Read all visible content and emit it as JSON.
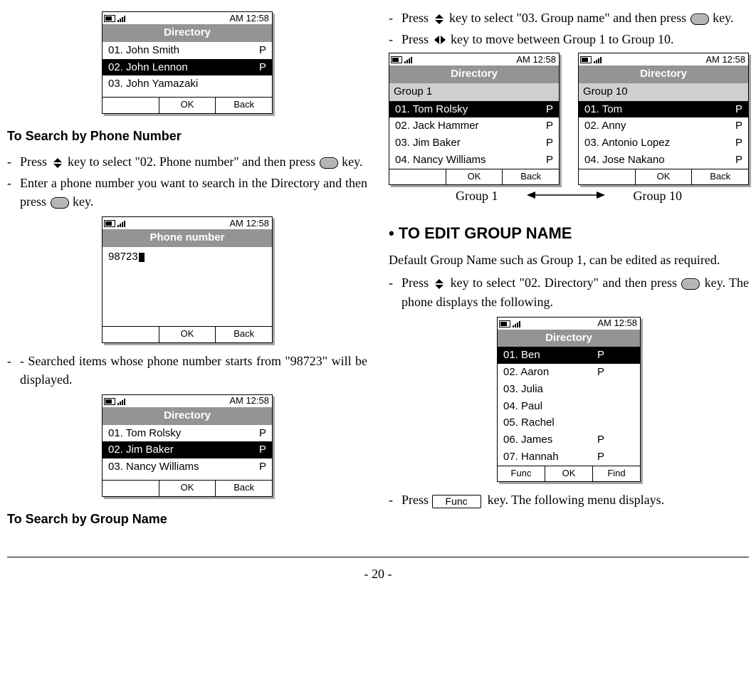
{
  "page_number": "- 20 -",
  "left": {
    "phone1": {
      "time": "AM 12:58",
      "title": "Directory",
      "rows": [
        {
          "text": "01. John Smith",
          "p": "P",
          "sel": false
        },
        {
          "text": "02. John Lennon",
          "p": "P",
          "sel": true
        },
        {
          "text": "03. John Yamazaki",
          "p": "",
          "sel": false
        }
      ],
      "soft_center": "OK",
      "soft_right": "Back"
    },
    "heading_phone": "To Search by Phone Number",
    "line1a": "- ",
    "line1b": "Press ",
    "line1c": " key to select \"02. Phone number\" and then press ",
    "line1d": " key.",
    "line2": "- Enter a phone number you want to search in the Directory and then press ",
    "line2b": " key.",
    "phone2": {
      "time": "AM 12:58",
      "title": "Phone number",
      "input_value": "98723",
      "soft_center": "OK",
      "soft_right": "Back"
    },
    "line3": "- Searched items whose phone number starts from \"98723\" will be displayed.",
    "phone3": {
      "time": "AM 12:58",
      "title": "Directory",
      "rows": [
        {
          "text": "01. Tom Rolsky",
          "p": "P",
          "sel": false
        },
        {
          "text": "02. Jim Baker",
          "p": "P",
          "sel": true
        },
        {
          "text": "03. Nancy Williams",
          "p": "P",
          "sel": false
        }
      ],
      "soft_center": "OK",
      "soft_right": "Back"
    },
    "heading_group": "To Search by Group Name"
  },
  "right": {
    "line1a": "- Press ",
    "line1b": " key to select \"03. Group name\" and then press ",
    "line1c": " key.",
    "line2a": "- Press ",
    "line2b": " key to move between Group 1 to Group 10.",
    "phone_g1": {
      "time": "AM 12:58",
      "title": "Directory",
      "sub": "Group 1",
      "rows": [
        {
          "text": "01. Tom Rolsky",
          "p": "P",
          "sel": true
        },
        {
          "text": "02. Jack Hammer",
          "p": "P",
          "sel": false
        },
        {
          "text": "03. Jim Baker",
          "p": "P",
          "sel": false
        },
        {
          "text": "04. Nancy Williams",
          "p": "P",
          "sel": false
        }
      ],
      "soft_center": "OK",
      "soft_right": "Back"
    },
    "phone_g10": {
      "time": "AM 12:58",
      "title": "Directory",
      "sub": "Group 10",
      "rows": [
        {
          "text": "01. Tom",
          "p": "P",
          "sel": true
        },
        {
          "text": "02. Anny",
          "p": "P",
          "sel": false
        },
        {
          "text": "03. Antonio Lopez",
          "p": "P",
          "sel": false
        },
        {
          "text": "04. Jose Nakano",
          "p": "P",
          "sel": false
        }
      ],
      "soft_center": "OK",
      "soft_right": "Back"
    },
    "group_label_left": "Group 1",
    "group_label_right": "Group 10",
    "section_heading": "• TO EDIT GROUP NAME",
    "intro": "Default Group Name such as Group 1, can be edited as required.",
    "line3a": "- Press ",
    "line3b": " key to select \"02. Directory\" and then press ",
    "line3c": " key. The phone displays the following.",
    "phone_dir": {
      "time": "AM 12:58",
      "title": "Directory",
      "rows": [
        {
          "text": "01. Ben",
          "p": "P",
          "sel": true
        },
        {
          "text": "02. Aaron",
          "p": "P",
          "sel": false
        },
        {
          "text": "03. Julia",
          "p": "",
          "sel": false
        },
        {
          "text": "04. Paul",
          "p": "",
          "sel": false
        },
        {
          "text": "05. Rachel",
          "p": "",
          "sel": false
        },
        {
          "text": "06. James",
          "p": "P",
          "sel": false
        },
        {
          "text": "07. Hannah",
          "p": "P",
          "sel": false
        }
      ],
      "soft_left": "Func",
      "soft_center": "OK",
      "soft_right": "Find"
    },
    "line4a": "- Press ",
    "func_btn": "Func",
    "line4b": " key. The following menu displays."
  }
}
